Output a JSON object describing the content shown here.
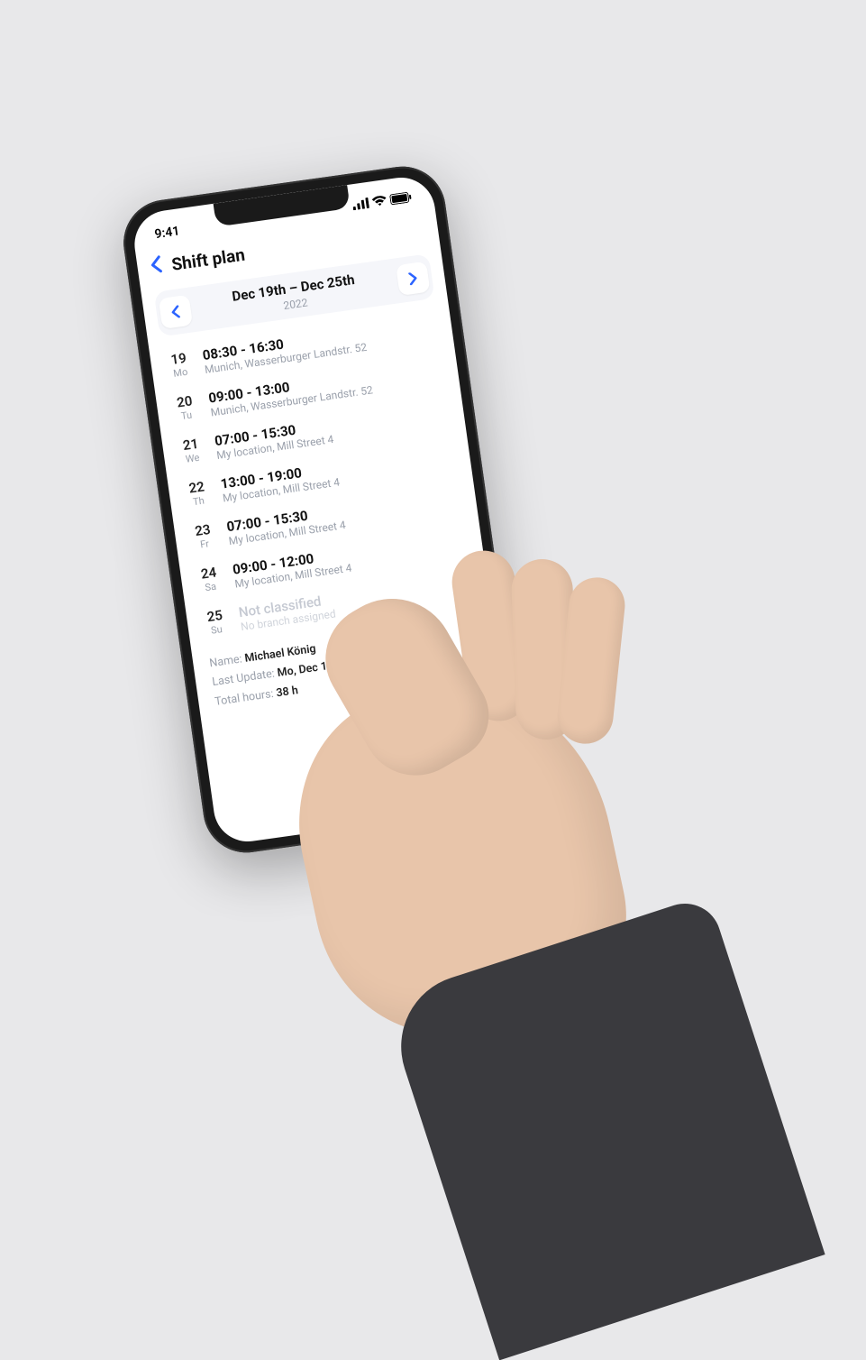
{
  "status": {
    "time": "9:41",
    "signal_label": "signal",
    "wifi_label": "wifi",
    "battery_label": "battery"
  },
  "nav": {
    "back_label": "Back",
    "title": "Shift plan"
  },
  "week": {
    "prev_label": "Previous week",
    "next_label": "Next week",
    "range": "Dec 19th – Dec 25th",
    "year": "2022"
  },
  "shifts": [
    {
      "daynum": "19",
      "daylabel": "Mo",
      "time": "08:30 - 16:30",
      "location": "Munich, Wasserburger Landstr. 52",
      "muted": false
    },
    {
      "daynum": "20",
      "daylabel": "Tu",
      "time": "09:00 - 13:00",
      "location": "Munich, Wasserburger Landstr. 52",
      "muted": false
    },
    {
      "daynum": "21",
      "daylabel": "We",
      "time": "07:00 - 15:30",
      "location": "My location, Mill Street 4",
      "muted": false
    },
    {
      "daynum": "22",
      "daylabel": "Th",
      "time": "13:00 - 19:00",
      "location": "My location, Mill Street 4",
      "muted": false
    },
    {
      "daynum": "23",
      "daylabel": "Fr",
      "time": "07:00 - 15:30",
      "location": "My location, Mill Street 4",
      "muted": false
    },
    {
      "daynum": "24",
      "daylabel": "Sa",
      "time": "09:00 - 12:00",
      "location": "My location, Mill Street 4",
      "muted": false
    },
    {
      "daynum": "25",
      "daylabel": "Su",
      "time": "Not classified",
      "location": "No branch assigned",
      "muted": true
    }
  ],
  "summary": {
    "name_label": "Name:",
    "name_value": "Michael König",
    "update_label": "Last Update:",
    "update_value": "Mo, Dec 12th 2022",
    "hours_label": "Total hours:",
    "hours_value": "38 h"
  }
}
